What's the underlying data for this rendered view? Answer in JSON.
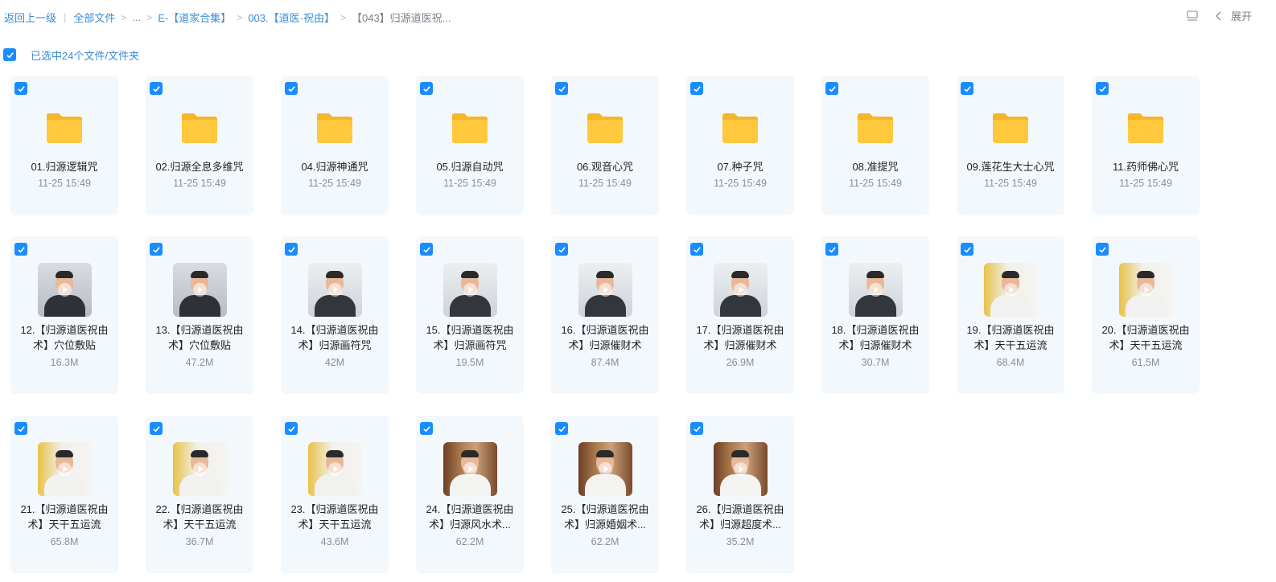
{
  "breadcrumb": {
    "back": "返回上一级",
    "all_files": "全部文件",
    "ellipsis": "...",
    "level1": "E-【道家合集】",
    "level2": "003.【道医·祝由】",
    "current": "【043】归源道医祝..."
  },
  "toolbar": {
    "layout_icon": "layout-icon",
    "expand_label": "展开"
  },
  "selection": {
    "text": "已选中24个文件/文件夹",
    "checked": true
  },
  "colors": {
    "accent": "#1a8cff",
    "link": "#3b8cd6",
    "card_bg": "#f3f8fd",
    "folder": "#ffc83d"
  },
  "folders": [
    {
      "name": "01.归源逻辑咒",
      "meta": "11-25 15:49"
    },
    {
      "name": "02.归源全息多维咒",
      "meta": "11-25 15:49"
    },
    {
      "name": "04.归源神通咒",
      "meta": "11-25 15:49"
    },
    {
      "name": "05.归源自动咒",
      "meta": "11-25 15:49"
    },
    {
      "name": "06.观音心咒",
      "meta": "11-25 15:49"
    },
    {
      "name": "07.种子咒",
      "meta": "11-25 15:49"
    },
    {
      "name": "08.准提咒",
      "meta": "11-25 15:49"
    },
    {
      "name": "09.莲花生大士心咒",
      "meta": "11-25 15:49"
    },
    {
      "name": "11.药师佛心咒",
      "meta": "11-25 15:49"
    }
  ],
  "videos": [
    {
      "name": "12.【归源道医祝由术】穴位敷贴",
      "meta": "16.3M",
      "scene": "office"
    },
    {
      "name": "13.【归源道医祝由术】穴位敷贴",
      "meta": "47.2M",
      "scene": "office"
    },
    {
      "name": "14.【归源道医祝由术】归源画符咒",
      "meta": "42M",
      "scene": "office-light"
    },
    {
      "name": "15.【归源道医祝由术】归源画符咒",
      "meta": "19.5M",
      "scene": "office-light"
    },
    {
      "name": "16.【归源道医祝由术】归源催财术",
      "meta": "87.4M",
      "scene": "office-light"
    },
    {
      "name": "17.【归源道医祝由术】归源催财术",
      "meta": "26.9M",
      "scene": "office-light"
    },
    {
      "name": "18.【归源道医祝由术】归源催财术",
      "meta": "30.7M",
      "scene": "office-light"
    },
    {
      "name": "19.【归源道医祝由术】天干五运流",
      "meta": "68.4M",
      "scene": "taiji"
    },
    {
      "name": "20.【归源道医祝由术】天干五运流",
      "meta": "61.5M",
      "scene": "taiji"
    },
    {
      "name": "21.【归源道医祝由术】天干五运流",
      "meta": "65.8M",
      "scene": "taiji"
    },
    {
      "name": "22.【归源道医祝由术】天干五运流",
      "meta": "36.7M",
      "scene": "taiji"
    },
    {
      "name": "23.【归源道医祝由术】天干五运流",
      "meta": "43.6M",
      "scene": "taiji"
    },
    {
      "name": "24.【归源道医祝由术】归源风水术...",
      "meta": "62.2M",
      "scene": "bookshelf"
    },
    {
      "name": "25.【归源道医祝由术】归源婚姻术...",
      "meta": "62.2M",
      "scene": "bookshelf"
    },
    {
      "name": "26.【归源道医祝由术】归源超度术...",
      "meta": "35.2M",
      "scene": "bookshelf"
    }
  ]
}
